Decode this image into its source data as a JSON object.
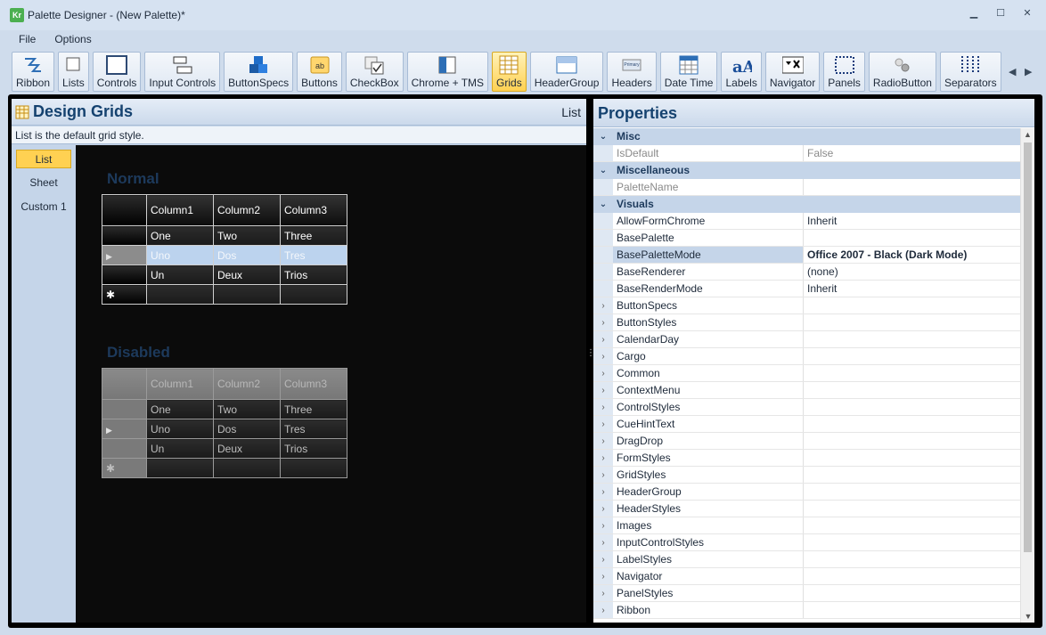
{
  "window": {
    "title": "Palette Designer - (New Palette)*",
    "icon_text": "Kr",
    "controls": [
      "▁",
      "☐",
      "✕"
    ]
  },
  "menu": [
    "File",
    "Options"
  ],
  "toolbar": {
    "items": [
      {
        "label": "Ribbon",
        "icon": "ribbon-icon",
        "active": false
      },
      {
        "label": "Lists",
        "icon": "lists-icon",
        "active": false
      },
      {
        "label": "Controls",
        "icon": "controls-icon",
        "active": false
      },
      {
        "label": "Input Controls",
        "icon": "input-controls-icon",
        "active": false
      },
      {
        "label": "ButtonSpecs",
        "icon": "buttonspecs-icon",
        "active": false
      },
      {
        "label": "Buttons",
        "icon": "buttons-icon",
        "active": false
      },
      {
        "label": "CheckBox",
        "icon": "checkbox-icon",
        "active": false
      },
      {
        "label": "Chrome + TMS",
        "icon": "chrome-tms-icon",
        "active": false
      },
      {
        "label": "Grids",
        "icon": "grids-icon",
        "active": true
      },
      {
        "label": "HeaderGroup",
        "icon": "headergroup-icon",
        "active": false
      },
      {
        "label": "Headers",
        "icon": "headers-icon",
        "active": false
      },
      {
        "label": "Date Time",
        "icon": "date-time-icon",
        "active": false
      },
      {
        "label": "Labels",
        "icon": "labels-icon",
        "active": false
      },
      {
        "label": "Navigator",
        "icon": "navigator-icon",
        "active": false
      },
      {
        "label": "Panels",
        "icon": "panels-icon",
        "active": false
      },
      {
        "label": "RadioButton",
        "icon": "radiobutton-icon",
        "active": false
      },
      {
        "label": "Separators",
        "icon": "separators-icon",
        "active": false
      }
    ],
    "scroll_left": "◀",
    "scroll_right": "▶"
  },
  "design": {
    "title": "Design Grids",
    "current_style": "List",
    "description": "List is the default grid style.",
    "styles": [
      "List",
      "Sheet",
      "Custom 1"
    ],
    "active_style": "List",
    "normal_heading": "Normal",
    "disabled_heading": "Disabled",
    "columns": [
      "Column1",
      "Column2",
      "Column3"
    ],
    "rows": [
      [
        "One",
        "Two",
        "Three"
      ],
      [
        "Uno",
        "Dos",
        "Tres"
      ],
      [
        "Un",
        "Deux",
        "Trios"
      ]
    ],
    "selected_row": 1,
    "new_row_marker": "✱",
    "row_arrow": "▶"
  },
  "properties": {
    "title": "Properties",
    "rows": [
      {
        "type": "cat",
        "name": "Misc",
        "expander": "⌄"
      },
      {
        "type": "ro",
        "name": "IsDefault",
        "value": "False"
      },
      {
        "type": "cat",
        "name": "Miscellaneous",
        "expander": "⌄"
      },
      {
        "type": "ro",
        "name": "PaletteName",
        "value": ""
      },
      {
        "type": "cat",
        "name": "Visuals",
        "expander": "⌄"
      },
      {
        "type": "prop",
        "name": "AllowFormChrome",
        "value": "Inherit"
      },
      {
        "type": "prop",
        "name": "BasePalette",
        "value": ""
      },
      {
        "type": "sel",
        "name": "BasePaletteMode",
        "value": "Office 2007 - Black (Dark Mode)"
      },
      {
        "type": "prop",
        "name": "BaseRenderer",
        "value": "(none)"
      },
      {
        "type": "prop",
        "name": "BaseRenderMode",
        "value": "Inherit"
      },
      {
        "type": "exp",
        "name": "ButtonSpecs",
        "value": ""
      },
      {
        "type": "exp",
        "name": "ButtonStyles",
        "value": ""
      },
      {
        "type": "exp",
        "name": "CalendarDay",
        "value": ""
      },
      {
        "type": "exp",
        "name": "Cargo",
        "value": ""
      },
      {
        "type": "exp",
        "name": "Common",
        "value": ""
      },
      {
        "type": "exp",
        "name": "ContextMenu",
        "value": ""
      },
      {
        "type": "exp",
        "name": "ControlStyles",
        "value": ""
      },
      {
        "type": "exp",
        "name": "CueHintText",
        "value": ""
      },
      {
        "type": "exp",
        "name": "DragDrop",
        "value": ""
      },
      {
        "type": "exp",
        "name": "FormStyles",
        "value": ""
      },
      {
        "type": "exp",
        "name": "GridStyles",
        "value": ""
      },
      {
        "type": "exp",
        "name": "HeaderGroup",
        "value": ""
      },
      {
        "type": "exp",
        "name": "HeaderStyles",
        "value": ""
      },
      {
        "type": "exp",
        "name": "Images",
        "value": ""
      },
      {
        "type": "exp",
        "name": "InputControlStyles",
        "value": ""
      },
      {
        "type": "exp",
        "name": "LabelStyles",
        "value": ""
      },
      {
        "type": "exp",
        "name": "Navigator",
        "value": ""
      },
      {
        "type": "exp",
        "name": "PanelStyles",
        "value": ""
      },
      {
        "type": "exp",
        "name": "Ribbon",
        "value": ""
      }
    ]
  }
}
